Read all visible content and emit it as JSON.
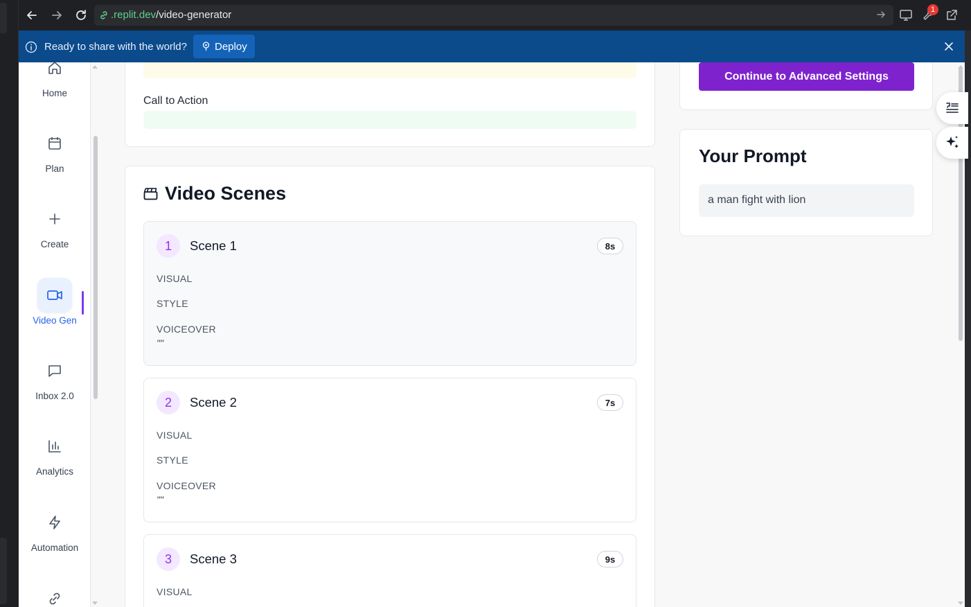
{
  "browser": {
    "url_host": ".replit.dev",
    "url_path": "/video-generator",
    "notification_count": "1"
  },
  "banner": {
    "message": "Ready to share with the world?",
    "deploy_label": "Deploy"
  },
  "sidebar": {
    "items": [
      {
        "label": "Home",
        "icon": "home-icon"
      },
      {
        "label": "Plan",
        "icon": "calendar-icon"
      },
      {
        "label": "Create",
        "icon": "plus-icon"
      },
      {
        "label": "Video Gen",
        "icon": "video-camera-icon",
        "active": true
      },
      {
        "label": "Inbox 2.0",
        "icon": "message-icon"
      },
      {
        "label": "Analytics",
        "icon": "bar-chart-icon"
      },
      {
        "label": "Automation",
        "icon": "lightning-icon"
      },
      {
        "label": "",
        "icon": "link-icon"
      }
    ]
  },
  "main": {
    "cta_label": "Call to Action",
    "scenes_title": "Video Scenes",
    "scenes": [
      {
        "number": "1",
        "title": "Scene 1",
        "duration": "8s",
        "visual": "VISUAL",
        "style": "STYLE",
        "voiceover": "VOICEOVER",
        "quote": "\"\""
      },
      {
        "number": "2",
        "title": "Scene 2",
        "duration": "7s",
        "visual": "VISUAL",
        "style": "STYLE",
        "voiceover": "VOICEOVER",
        "quote": "\"\""
      },
      {
        "number": "3",
        "title": "Scene 3",
        "duration": "9s",
        "visual": "VISUAL"
      }
    ]
  },
  "right": {
    "continue_label": "Continue to Advanced Settings",
    "prompt_title": "Your Prompt",
    "prompt_text": "a man fight with lion"
  },
  "colors": {
    "accent_purple": "#7e22ce",
    "banner_blue": "#0b4a8b",
    "active_blue": "#2563eb"
  }
}
